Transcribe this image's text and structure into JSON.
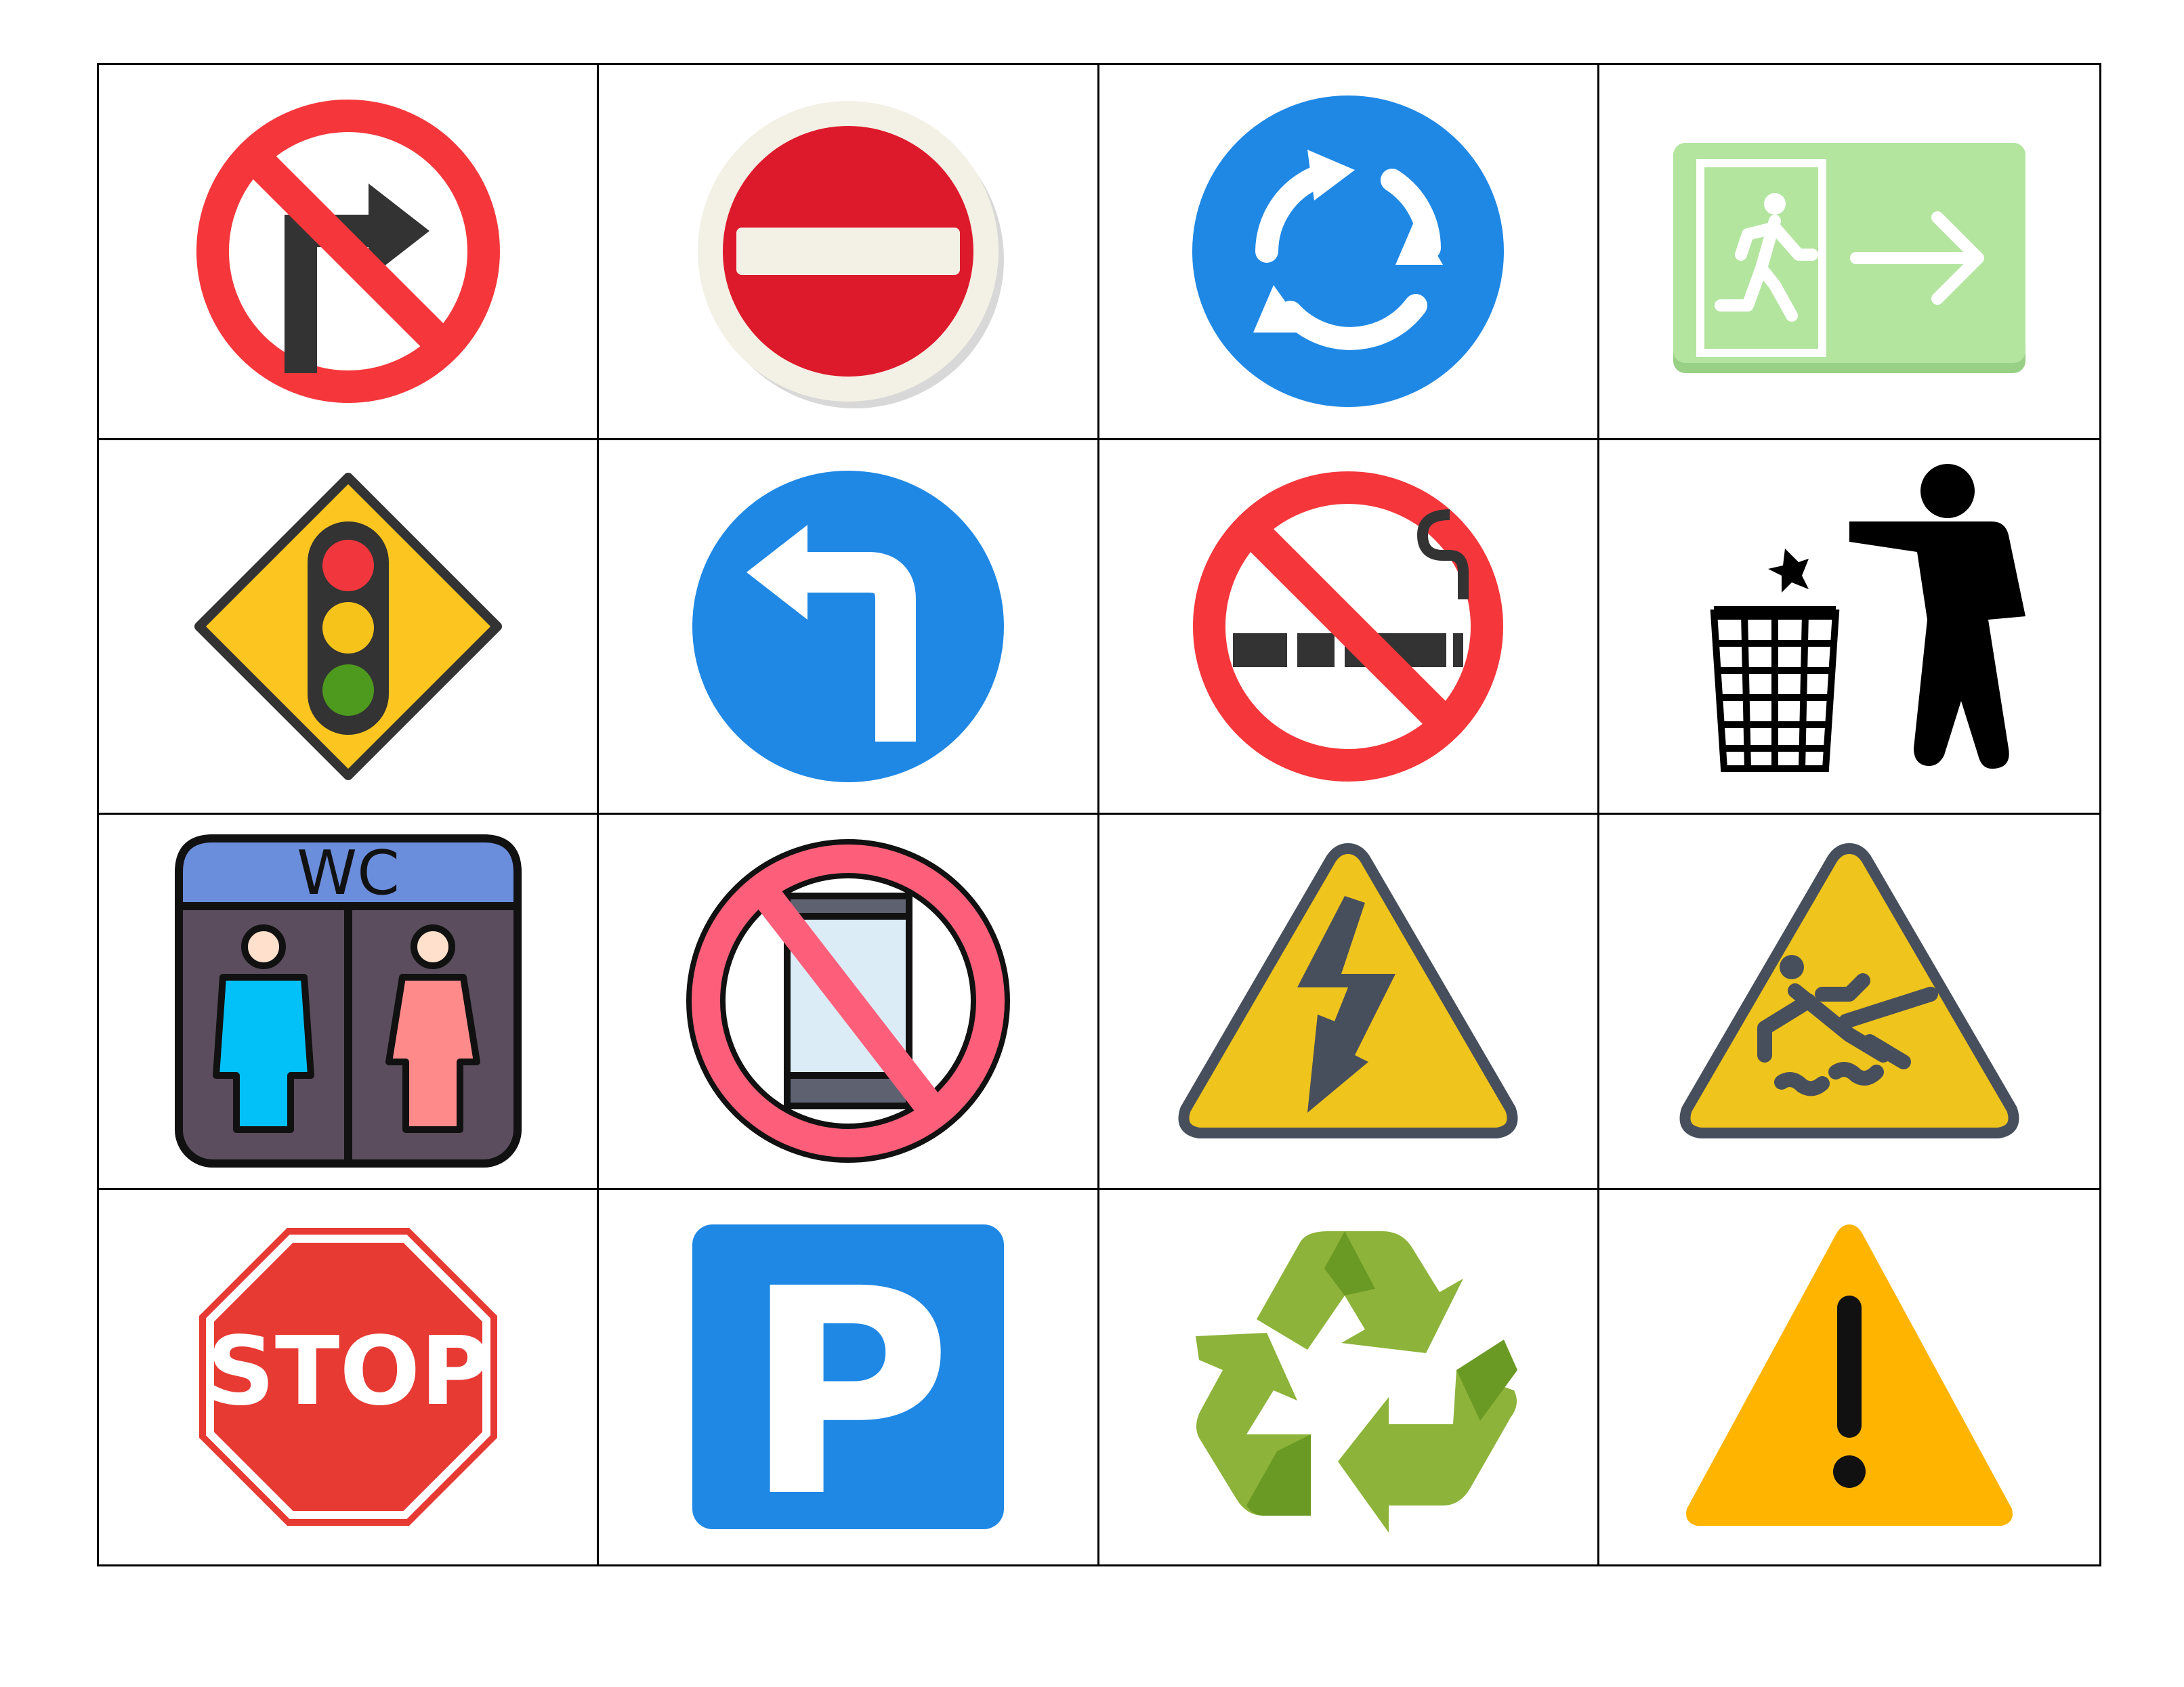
{
  "grid": {
    "columns": 4,
    "rows": 4
  },
  "colors": {
    "red": "#f5373b",
    "dark": "#333333",
    "noentry_red": "#dd1a2b",
    "cream": "#f3f1e6",
    "blue": "#1f88e5",
    "exit_green": "#b3e59f",
    "sign_yellow": "#fcc51f",
    "traffic_red": "#f1363d",
    "traffic_yellow": "#f6c31b",
    "traffic_green": "#4d9a1e",
    "wc_header": "#6a8ddc",
    "wc_body": "#5b4d5e",
    "wc_male": "#02c1f9",
    "wc_female": "#ff8a8a",
    "phone_ring": "#fd5f7a",
    "hazard_yellow": "#efc41c",
    "hazard_dark": "#474f5c",
    "stop_red": "#e63a33",
    "recycle_light": "#8db33a",
    "recycle_dark": "#6a9924",
    "warning_amber": "#ffb400"
  },
  "signs": [
    {
      "icon": "no-right-turn-icon"
    },
    {
      "icon": "no-entry-icon"
    },
    {
      "icon": "roundabout-icon"
    },
    {
      "icon": "emergency-exit-icon"
    },
    {
      "icon": "traffic-light-ahead-icon"
    },
    {
      "icon": "turn-left-icon"
    },
    {
      "icon": "no-smoking-icon"
    },
    {
      "icon": "litter-bin-icon"
    },
    {
      "icon": "wc-restroom-icon",
      "text": "WC"
    },
    {
      "icon": "no-mobile-phone-icon"
    },
    {
      "icon": "high-voltage-icon"
    },
    {
      "icon": "wet-floor-icon"
    },
    {
      "icon": "stop-sign-icon",
      "text": "STOP"
    },
    {
      "icon": "parking-icon",
      "text": "P"
    },
    {
      "icon": "recycling-icon"
    },
    {
      "icon": "warning-exclamation-icon",
      "text": "!"
    }
  ]
}
